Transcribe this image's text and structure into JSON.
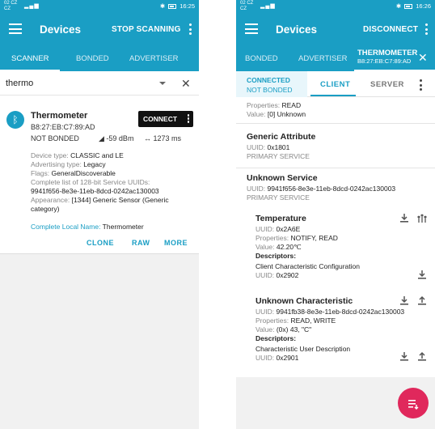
{
  "left": {
    "status": {
      "carrier1": "02 CZ",
      "carrier2": "CZ",
      "time": "16:25"
    },
    "appbar": {
      "title": "Devices",
      "action": "STOP SCANNING"
    },
    "tabs": [
      "SCANNER",
      "BONDED",
      "ADVERTISER"
    ],
    "search": {
      "value": "thermo"
    },
    "device": {
      "name": "Thermometer",
      "address": "B8:27:EB:C7:89:AD",
      "bond_state": "NOT BONDED",
      "rssi": "-59 dBm",
      "interval": "1273 ms",
      "connect_label": "CONNECT",
      "info": [
        {
          "k": "Device type: ",
          "v": "CLASSIC and LE"
        },
        {
          "k": "Advertising type: ",
          "v": "Legacy"
        },
        {
          "k": "Flags: ",
          "v": "GeneralDiscoverable"
        },
        {
          "k": "Complete list of 128-bit Service UUIDs:",
          "v": "9941f656-8e3e-11eb-8dcd-0242ac130003"
        },
        {
          "k": "Appearance: ",
          "v": "[1344] Generic Sensor (Generic category)"
        },
        {
          "k": "Complete Local Name: ",
          "v": "Thermometer"
        }
      ],
      "actions": [
        "CLONE",
        "RAW",
        "MORE"
      ]
    }
  },
  "right": {
    "status": {
      "carrier1": "02 CZ",
      "carrier2": "CZ",
      "time": "16:26"
    },
    "appbar": {
      "title": "Devices",
      "action": "DISCONNECT"
    },
    "tabs": [
      "BONDED",
      "ADVERTISER"
    ],
    "device_tab": {
      "name": "THERMOMETER",
      "address": "B8:27:EB:C7:89:AD"
    },
    "connection": {
      "state": "CONNECTED",
      "bond": "NOT BONDED"
    },
    "subtabs": [
      "CLIENT",
      "SERVER"
    ],
    "top_fragment": {
      "properties_label": "Properties: ",
      "properties": "READ",
      "value_label": "Value: ",
      "value": "[0] Unknown"
    },
    "services": [
      {
        "name": "Generic Attribute",
        "uuid_label": "UUID: ",
        "uuid": "0x1801",
        "type": "PRIMARY SERVICE"
      },
      {
        "name": "Unknown Service",
        "uuid_label": "UUID: ",
        "uuid": "9941f656-8e3e-11eb-8dcd-0242ac130003",
        "type": "PRIMARY SERVICE"
      }
    ],
    "characteristics": [
      {
        "name": "Temperature",
        "uuid": "0x2A6E",
        "properties": "NOTIFY, READ",
        "value": "42.20℃",
        "descriptors_label": "Descriptors:",
        "descriptor_name": "Client Characteristic Configuration",
        "descriptor_uuid": "0x2902"
      },
      {
        "name": "Unknown Characteristic",
        "uuid": "9941fb38-8e3e-11eb-8dcd-0242ac130003",
        "properties": "READ, WRITE",
        "value": "(0x) 43, \"C\"",
        "descriptors_label": "Descriptors:",
        "descriptor_name": "Characteristic User Description",
        "descriptor_uuid": "0x2901"
      }
    ],
    "labels": {
      "uuid": "UUID: ",
      "properties": "Properties: ",
      "value": "Value: "
    }
  }
}
